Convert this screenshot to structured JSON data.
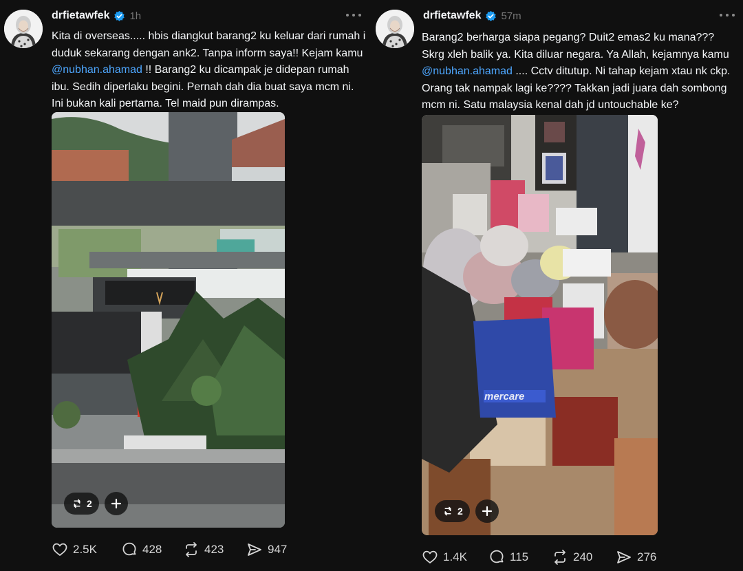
{
  "posts": [
    {
      "username": "drfietawfek",
      "time": "1h",
      "text_before": "Kita di overseas..... hbis diangkut barang2 ku keluar dari rumah i duduk sekarang dengan ank2. Tanpa inform saya!! Kejam kamu ",
      "mention": "@nubhan.ahamad",
      "text_after": " !! Barang2 ku dicampak je didepan rumah ibu. Sedih diperlaku begini. Pernah dah dia buat saya mcm ni. Ini bukan kali pertama. Tel maid pun dirampas.",
      "media_repost_count": "2",
      "likes": "2.5K",
      "comments": "428",
      "reposts": "423",
      "shares": "947"
    },
    {
      "username": "drfietawfek",
      "time": "57m",
      "text_before": "Barang2 berharga siapa pegang? Duit2 emas2 ku mana??? Skrg xleh balik ya. Kita diluar negara. Ya Allah, kejamnya kamu ",
      "mention": "@nubhan.ahamad",
      "text_after": " .... Cctv ditutup. Ni tahap kejam xtau nk ckp. Orang tak nampak lagi ke???? Takkan jadi juara dah sombong mcm ni. Satu malaysia kenal dah jd untouchable ke?",
      "media_repost_count": "2",
      "bag_logo": "mercare",
      "likes": "1.4K",
      "comments": "115",
      "reposts": "240",
      "shares": "276"
    }
  ],
  "colors": {
    "background": "#101010",
    "text": "#f3f5f7",
    "muted": "#777777",
    "mention": "#4ea7ff",
    "verified": "#1d9bf0"
  },
  "icons": [
    "verified-badge-icon",
    "more-options-icon",
    "repost-icon",
    "plus-icon",
    "heart-icon",
    "comment-icon",
    "share-icon"
  ]
}
